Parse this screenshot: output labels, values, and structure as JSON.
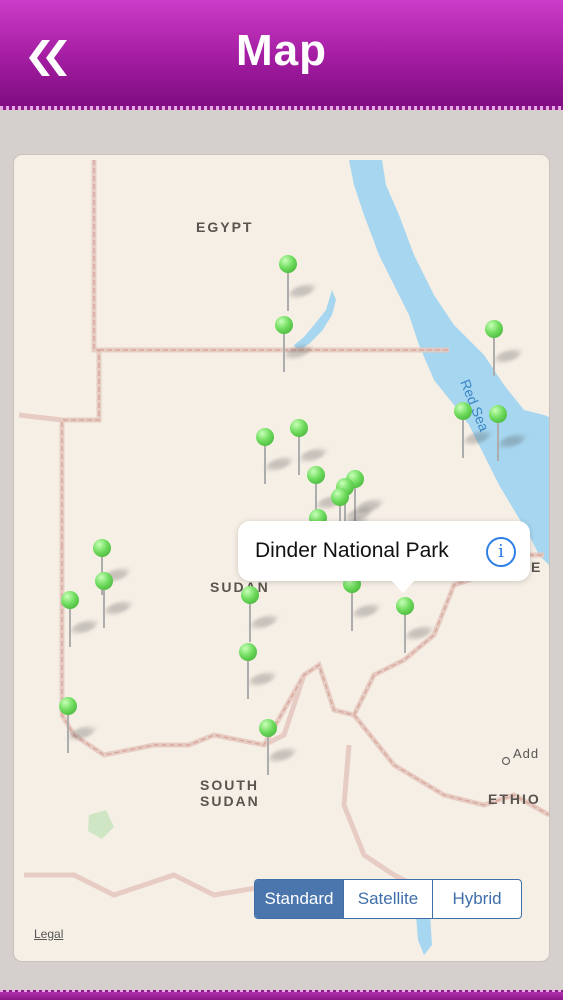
{
  "header": {
    "title": "Map",
    "back_icon": "double-chevron-left-icon"
  },
  "map": {
    "country_labels": {
      "egypt": "EGYPT",
      "sudan": "SUDAN",
      "south_sudan_1": "SOUTH",
      "south_sudan_2": "SUDAN",
      "ethiopia": "ETHIO",
      "eritrea_partial": "E",
      "addis": "Add"
    },
    "sea_label": "Red Sea",
    "callout": {
      "title": "Dinder National Park",
      "info_icon": "info-icon"
    },
    "pin_color": "#5fd34f",
    "water_color": "#a6d6f0"
  },
  "map_type": {
    "options": [
      "Standard",
      "Satellite",
      "Hybrid"
    ],
    "selected": "Standard"
  },
  "legal": "Legal"
}
